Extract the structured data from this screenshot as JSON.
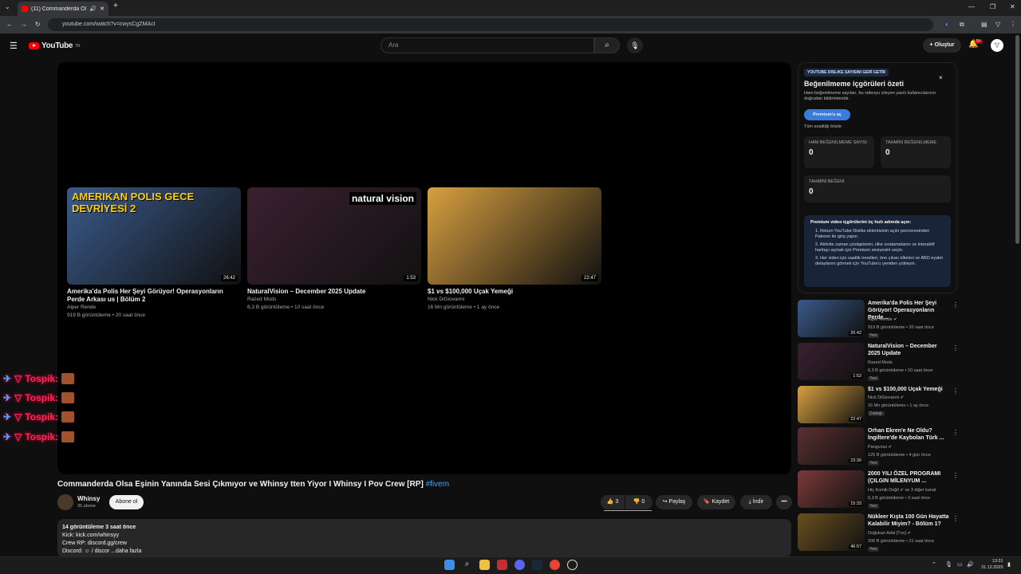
{
  "browser": {
    "tab_title": "(11) Commanderda Olsa E...",
    "url": "youtube.com/watch?v=cwysCgZMAcI",
    "new_tab": "+"
  },
  "header": {
    "logo": "YouTube",
    "logo_region": "TR",
    "search_placeholder": "Ara",
    "create_label": "+ Oluştur",
    "notif_count": "9+",
    "avatar_letter": "▽"
  },
  "end_cards": [
    {
      "title": "Amerika'da Polis Her Şeyi Görüyor! Operasyonların Perde Arkası us | Bölüm 2",
      "channel": "Alper Rende",
      "meta": "919 B görüntüleme • 20 saat önce",
      "duration": "26:42",
      "thumb_text": "AMERIKAN POLIS GECE DEVRİYESİ 2",
      "color": "#3a5a8a"
    },
    {
      "title": "NaturalVision – December 2025 Update",
      "channel": "Razed Mods",
      "meta": "6,3 B görüntüleme • 10 saat önce",
      "duration": "1:53",
      "thumb_text": "natural vision",
      "color": "#3a2030"
    },
    {
      "title": "$1 vs $100,000 Uçak Yemeği",
      "channel": "Nick DiGiovanni",
      "meta": "16 Mn görüntüleme • 1 ay önce",
      "duration": "22:47",
      "thumb_text": "",
      "color": "#d8a040"
    }
  ],
  "chat_overlay": [
    {
      "user": "Tospik:"
    },
    {
      "user": "Tospik:"
    },
    {
      "user": "Tospik:"
    },
    {
      "user": "Tospik:"
    }
  ],
  "video": {
    "title": "Commanderda Olsa Eşinin Yanında Sesi Çıkmıyor ve Whinsy tten Yiyor I Whinsy I Pov Crew [RP]",
    "hashtag": "#fivem",
    "channel": "Whinsy",
    "subs": "35 abone",
    "subscribe": "Abone ol",
    "likes": "3",
    "dislikes": "0",
    "share": "Paylaş",
    "save": "Kaydet",
    "download": "İndir",
    "more": "•••"
  },
  "description": {
    "line1": "14 görüntüleme  3 saat önce",
    "line2": "Kick: kick.com/whinsyy",
    "line3": "Crew RP: discord.gg/crew",
    "line4": "Discord: ☺ / discor  ...daha fazla"
  },
  "ryd": {
    "tag": "YOUTUBE DISLIKE SAYISINI GERİ GETİR",
    "heading": "Beğenilmeme içgörüleri özeti",
    "para": "Ham beğenilmeme sayıları, bu videoyu izleyen yazılı kullanıcılarının doğrudan bildirimleridir.",
    "btn": "Premium'u aç",
    "link": "Tüm analitiği önizle",
    "close": "×",
    "stats": [
      {
        "label": "HAM BEĞENİLMEME SAYISI",
        "value": "0"
      },
      {
        "label": "TAHMİNİ BEĞENİLMEME",
        "value": "0"
      },
      {
        "label": "TAHMİNİ BEĞENİ",
        "value": "0"
      }
    ],
    "box_title": "Premium video içgörülerini üç hızlı adımda açın:",
    "steps": [
      "1.  Return YouTube Dislike eklentisinin açılır penceresinden Patreon ile giriş yapın.",
      "2.  Aktivite zaman çizelgelerini, ülke sıralamalarını ve interaktif haritayı açmak için Premium seviyesini seçin.",
      "3.  Her video için saatlik trendleri, öne çıkan ülkeleri ve ABD eyalet detaylarını görmek için YouTube'u yeniden yükleyin."
    ]
  },
  "sidebar": [
    {
      "title": "Amerika'da Polis Her Şeyi Görüyor! Operasyonların Perde...",
      "channel": "Alper Rende ✔",
      "meta": "919 B görüntüleme • 20 saat önce",
      "badge": "Yeni",
      "duration": "26:42",
      "color": "#3a5a8a"
    },
    {
      "title": "NaturalVision – December 2025 Update",
      "channel": "Razed Mods",
      "meta": "6,3 B görüntüleme • 10 saat önce",
      "badge": "Yeni",
      "duration": "1:53",
      "color": "#3a2030"
    },
    {
      "title": "$1 vs $100,000 Uçak Yemeği",
      "channel": "Nick DiGiovanni ✔",
      "meta": "16 Mn görüntüleme • 1 ay önce",
      "badge": "Dublajlı",
      "duration": "22:47",
      "color": "#d8a040"
    },
    {
      "title": "Orhan Ekren'e Ne Oldu? İngiltere'de Kaybolan Türk ...",
      "channel": "Pangvoss ✔",
      "meta": "125 B görüntüleme • 4 gün önce",
      "badge": "Yeni",
      "duration": "23:30",
      "color": "#5a3030"
    },
    {
      "title": "2000 YILI ÖZEL PROGRAMI (ÇILGIN MİLENYUM ...",
      "channel": "Hiç Komik Değil ✔ ve 3 diğer kanal",
      "meta": "6,3 B görüntüleme • 3 saat önce",
      "badge": "Yeni",
      "duration": "15:33",
      "color": "#7a3a3a"
    },
    {
      "title": "Nükleer Kışta 100 Gün Hayatta Kalabilir Miyim? - Bölüm 1?",
      "channel": "Doğukan Adal [Tvo] ✔",
      "meta": "206 B görüntüleme • 21 saat önce",
      "badge": "Yeni",
      "duration": "46:57",
      "color": "#6a5020"
    }
  ],
  "taskbar": {
    "time": "13:31",
    "date": "31.12.2025"
  }
}
